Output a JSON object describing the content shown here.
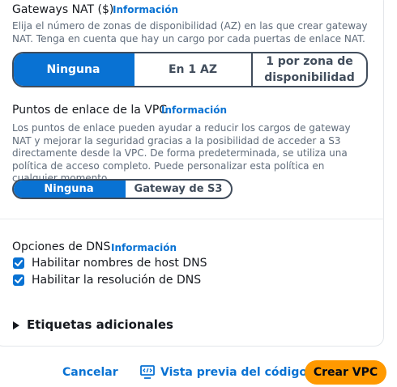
{
  "nat_gateways": {
    "label": "Gateways NAT ($)",
    "info": "Información",
    "description": "Elija el número de zonas de disponibilidad (AZ) en las que crear gateway NAT. Tenga en cuenta que hay un cargo por cada puertas de enlace NAT.",
    "options": [
      "Ninguna",
      "En 1 AZ",
      "1 por zona de disponibilidad"
    ],
    "selected": "Ninguna"
  },
  "vpc_endpoints": {
    "label": "Puntos de enlace de la VPC",
    "info": "Información",
    "description": "Los puntos de enlace pueden ayudar a reducir los cargos de gateway NAT y mejorar la seguridad gracias a la posibilidad de acceder a S3 directamente desde la VPC. De forma predeterminada, se utiliza una política de acceso completo. Puede personalizar esta política en cualquier momento.",
    "options": [
      "Ninguna",
      "Gateway de S3"
    ],
    "selected": "Ninguna"
  },
  "dns_options": {
    "label": "Opciones de DNS",
    "info": "Información",
    "checkboxes": [
      {
        "label": "Habilitar nombres de host DNS",
        "checked": true
      },
      {
        "label": "Habilitar la resolución de DNS",
        "checked": true
      }
    ]
  },
  "additional_tags": {
    "label": "Etiquetas adicionales"
  },
  "footer": {
    "cancel": "Cancelar",
    "preview": "Vista previa del código",
    "create": "Crear VPC"
  },
  "colors": {
    "accent": "#0972d3",
    "primary_button": "#ff9900",
    "text": "#16191f",
    "secondary_text": "#5f6b7a"
  }
}
